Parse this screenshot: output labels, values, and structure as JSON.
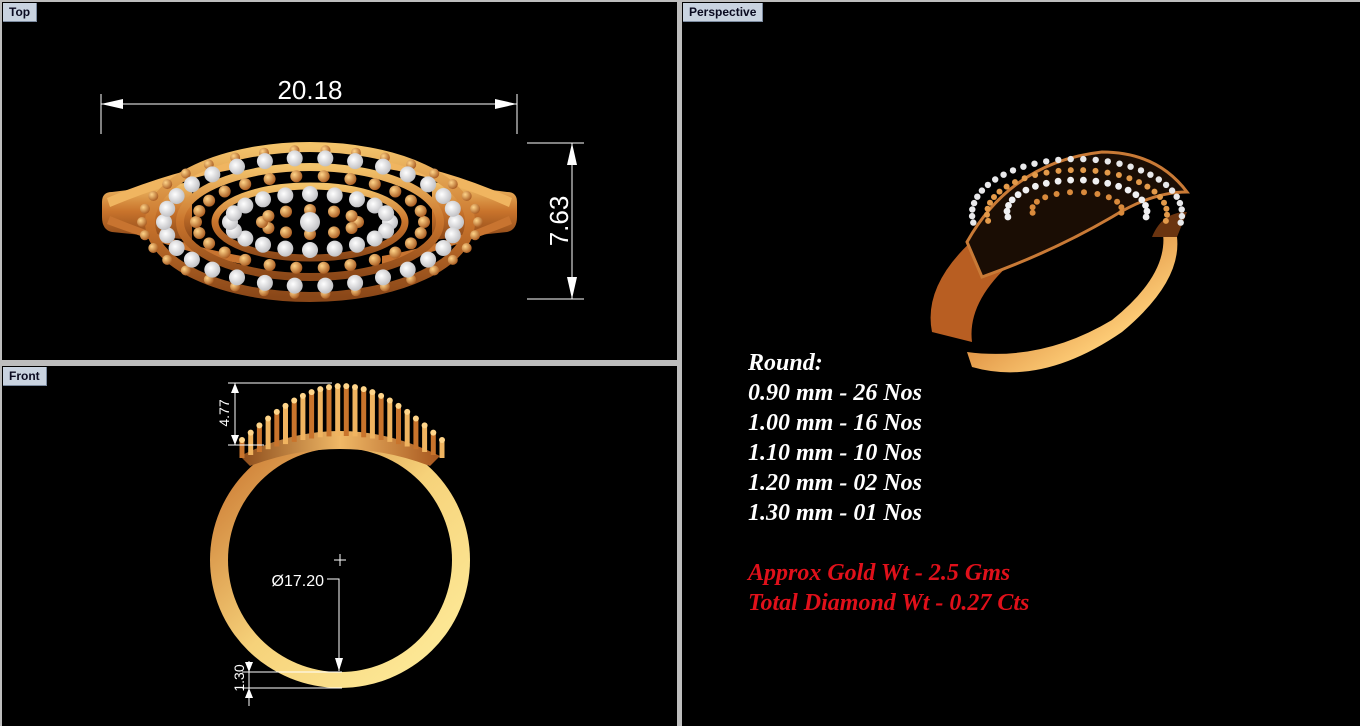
{
  "viewports": {
    "top": {
      "label": "Top",
      "dim_width": "20.18",
      "dim_height": "7.63"
    },
    "front": {
      "label": "Front",
      "dim_diameter": "Ø17.20",
      "dim_top": "4.77",
      "dim_bottom": "1.30"
    },
    "perspective": {
      "label": "Perspective",
      "round_heading": "Round:",
      "stones": [
        "0.90 mm - 26 Nos",
        "1.00 mm - 16 Nos",
        "1.10 mm - 10 Nos",
        "1.20 mm - 02 Nos",
        "1.30 mm - 01 Nos"
      ],
      "gold_weight": "Approx Gold Wt - 2.5 Gms",
      "diamond_weight": "Total Diamond Wt - 0.27 Cts"
    }
  },
  "colors": {
    "gold": "#d98a3c",
    "gold_light": "#f2c46a",
    "diamond": "#e8e8ea",
    "annotation_red": "#e0101a",
    "viewport_bg": "#000000"
  }
}
